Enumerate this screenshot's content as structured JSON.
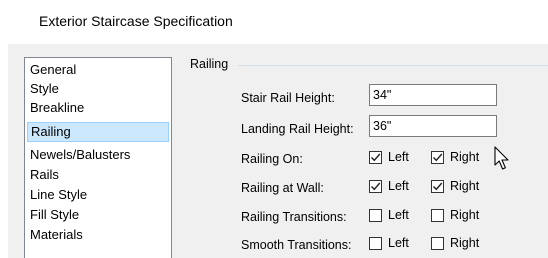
{
  "window": {
    "title": "Exterior Staircase Specification"
  },
  "nav": {
    "items": [
      {
        "label": "General",
        "selected": false
      },
      {
        "label": "Style",
        "selected": false
      },
      {
        "label": "Breakline",
        "selected": false
      },
      {
        "label": "Railing",
        "selected": true
      },
      {
        "label": "Newels/Balusters",
        "selected": false
      },
      {
        "label": "Rails",
        "selected": false
      },
      {
        "label": "Line Style",
        "selected": false
      },
      {
        "label": "Fill Style",
        "selected": false
      },
      {
        "label": "Materials",
        "selected": false
      }
    ]
  },
  "railing": {
    "group_label": "Railing",
    "stair_rail_height": {
      "label": "Stair Rail Height:",
      "value": "34\""
    },
    "landing_rail_height": {
      "label": "Landing Rail Height:",
      "value": "36\""
    },
    "rows": [
      {
        "label": "Railing On:",
        "left": {
          "label": "Left",
          "checked": true
        },
        "right": {
          "label": "Right",
          "checked": true
        }
      },
      {
        "label": "Railing at Wall:",
        "left": {
          "label": "Left",
          "checked": true
        },
        "right": {
          "label": "Right",
          "checked": true
        }
      },
      {
        "label": "Railing Transitions:",
        "left": {
          "label": "Left",
          "checked": false
        },
        "right": {
          "label": "Right",
          "checked": false
        }
      },
      {
        "label": "Smooth Transitions:",
        "left": {
          "label": "Left",
          "checked": false
        },
        "right": {
          "label": "Right",
          "checked": false
        }
      }
    ]
  },
  "icons": {
    "check": "checkmark-icon",
    "pointer": "mouse-pointer-icon"
  }
}
